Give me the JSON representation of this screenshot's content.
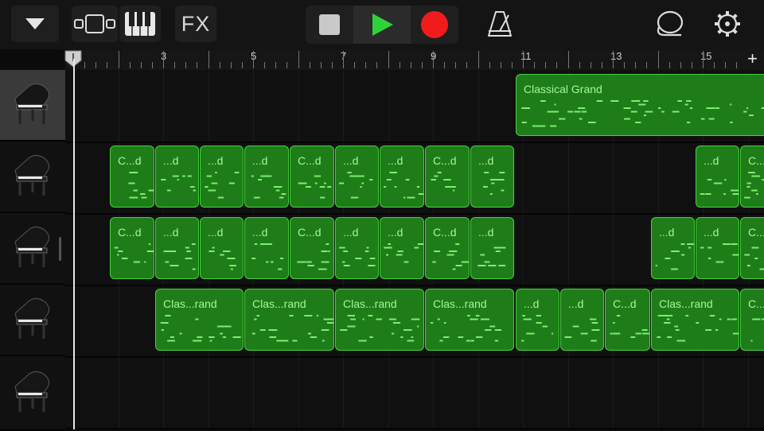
{
  "toolbar": {
    "fx_label": "FX",
    "buttons": [
      "tracks-menu",
      "view-toggle",
      "keyboard",
      "fx",
      "stop",
      "play",
      "record",
      "metronome",
      "loops",
      "settings"
    ]
  },
  "ruler": {
    "bar_numbers": [
      "3",
      "5",
      "7",
      "9",
      "11",
      "13",
      "15"
    ],
    "add_label": "+"
  },
  "tracks": [
    {
      "instrument": "grand-piano"
    },
    {
      "instrument": "grand-piano"
    },
    {
      "instrument": "grand-piano"
    },
    {
      "instrument": "grand-piano"
    },
    {
      "instrument": "grand-piano"
    }
  ],
  "regions": {
    "track1": [
      "Classical Grand"
    ],
    "track2": [
      "C...d",
      "...d",
      "...d",
      "...d",
      "C...d",
      "...d",
      "...d",
      "C...d",
      "...d",
      "...d",
      "C..."
    ],
    "track3": [
      "C...d",
      "...d",
      "...d",
      "...d",
      "C...d",
      "...d",
      "...d",
      "C...d",
      "...d",
      "...d",
      "...d",
      "C..."
    ],
    "track4": [
      "Clas...rand",
      "Clas...rand",
      "Clas...rand",
      "Clas...rand",
      "...d",
      "...d",
      "C...d",
      "Clas...rand",
      "C..."
    ]
  },
  "colors": {
    "region_fill": "#1e7d19",
    "region_border": "#46d33c",
    "region_text": "#a6f59a",
    "record": "#f01c1c",
    "play": "#2fd23a"
  }
}
